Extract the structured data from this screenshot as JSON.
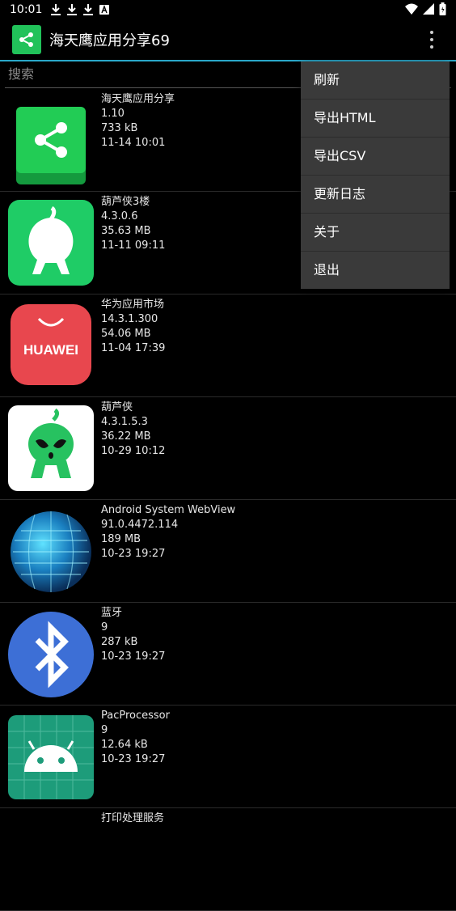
{
  "status": {
    "time": "10:01"
  },
  "header": {
    "title": "海天鹰应用分享69"
  },
  "search": {
    "placeholder": "搜索"
  },
  "apps": [
    {
      "name": "海天鹰应用分享",
      "version": "1.10",
      "size": "733 kB",
      "date": "11-14 10:01",
      "icon": "share-icon"
    },
    {
      "name": "葫芦侠3楼",
      "version": "4.3.0.6",
      "size": "35.63 MB",
      "date": "11-11 09:11",
      "icon": "gourd-icon"
    },
    {
      "name": "华为应用市场",
      "version": "14.3.1.300",
      "size": "54.06 MB",
      "date": "11-04 17:39",
      "icon": "huawei-bag-icon",
      "brand": "HUAWEI"
    },
    {
      "name": "葫芦侠",
      "version": "4.3.1.5.3",
      "size": "36.22 MB",
      "date": "10-29 10:12",
      "icon": "alien-icon"
    },
    {
      "name": "Android System WebView",
      "version": "91.0.4472.114",
      "size": "189 MB",
      "date": "10-23 19:27",
      "icon": "globe-icon"
    },
    {
      "name": "蓝牙",
      "version": "9",
      "size": "287 kB",
      "date": "10-23 19:27",
      "icon": "bluetooth-icon"
    },
    {
      "name": "PacProcessor",
      "version": "9",
      "size": "12.64 kB",
      "date": "10-23 19:27",
      "icon": "android-icon"
    },
    {
      "name": "打印处理服务",
      "version": "",
      "size": "",
      "date": "",
      "icon": "print-icon"
    }
  ],
  "menu": {
    "items": [
      "刷新",
      "导出HTML",
      "导出CSV",
      "更新日志",
      "关于",
      "退出"
    ]
  },
  "colors": {
    "accent": "#2aa7c9",
    "green": "#21c25a",
    "huawei": "#e8474e",
    "bluetooth": "#3d6fd6"
  }
}
